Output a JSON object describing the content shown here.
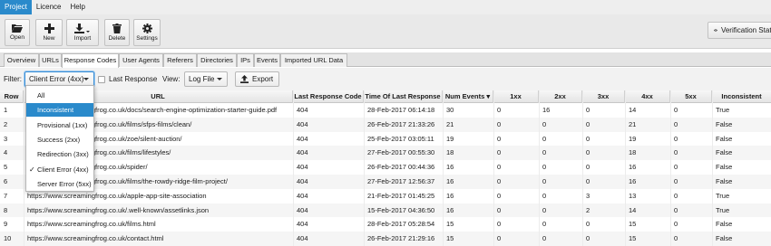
{
  "menu": [
    {
      "label": "Project",
      "active": true
    },
    {
      "label": "Licence",
      "active": false
    },
    {
      "label": "Help",
      "active": false
    }
  ],
  "toolbar": {
    "open_label": "Open",
    "new_label": "New",
    "import_label": "Import",
    "delete_label": "Delete",
    "settings_label": "Settings",
    "verification_label": "Verification Status"
  },
  "tabs": [
    "Overview",
    "URLs",
    "Response Codes",
    "User Agents",
    "Referers",
    "Directories",
    "IPs",
    "Events",
    "Imported URL Data"
  ],
  "active_tab": "Response Codes",
  "filter": {
    "filter_label": "Filter:",
    "filter_value": "Client Error (4xx)",
    "last_response_label": "Last Response",
    "view_label": "View:",
    "view_value": "Log File",
    "export_label": "Export"
  },
  "dropdown": {
    "options": [
      "All",
      "Inconsistent",
      "Provisional (1xx)",
      "Success (2xx)",
      "Redirection (3xx)",
      "Client Error (4xx)",
      "Server Error (5xx)"
    ],
    "highlighted": "Inconsistent",
    "checked": "Client Error (4xx)",
    "check_mark": "✓"
  },
  "table": {
    "columns": [
      "Row",
      "URL",
      "Last Response Code",
      "Time Of Last Response",
      "Num Events ▾",
      "1xx",
      "2xx",
      "3xx",
      "4xx",
      "5xx",
      "Inconsistent"
    ],
    "rows": [
      [
        "1",
        "https://www.screamingfrog.co.uk/docs/search-engine-optimization-starter-guide.pdf",
        "404",
        "28-Feb-2017 06:14:18",
        "30",
        "0",
        "16",
        "0",
        "14",
        "0",
        "True"
      ],
      [
        "2",
        "https://www.screamingfrog.co.uk/films/sfps-films/clean/",
        "404",
        "26-Feb-2017 21:33:26",
        "21",
        "0",
        "0",
        "0",
        "21",
        "0",
        "False"
      ],
      [
        "3",
        "https://www.screamingfrog.co.uk/zoe/silent-auction/",
        "404",
        "25-Feb-2017 03:05:11",
        "19",
        "0",
        "0",
        "0",
        "19",
        "0",
        "False"
      ],
      [
        "4",
        "https://www.screamingfrog.co.uk/films/lifestyles/",
        "404",
        "27-Feb-2017 00:55:30",
        "18",
        "0",
        "0",
        "0",
        "18",
        "0",
        "False"
      ],
      [
        "5",
        "https://www.screamingfrog.co.uk/spider/",
        "404",
        "26-Feb-2017 00:44:36",
        "16",
        "0",
        "0",
        "0",
        "16",
        "0",
        "False"
      ],
      [
        "6",
        "https://www.screamingfrog.co.uk/films/the-rowdy-ridge-film-project/",
        "404",
        "27-Feb-2017 12:56:37",
        "16",
        "0",
        "0",
        "0",
        "16",
        "0",
        "False"
      ],
      [
        "7",
        "https://www.screamingfrog.co.uk/apple-app-site-association",
        "404",
        "21-Feb-2017 01:45:25",
        "16",
        "0",
        "0",
        "3",
        "13",
        "0",
        "True"
      ],
      [
        "8",
        "https://www.screamingfrog.co.uk/.well-known/assetlinks.json",
        "404",
        "15-Feb-2017 04:36:50",
        "16",
        "0",
        "0",
        "2",
        "14",
        "0",
        "True"
      ],
      [
        "9",
        "https://www.screamingfrog.co.uk/films.html",
        "404",
        "28-Feb-2017 05:28:54",
        "15",
        "0",
        "0",
        "0",
        "15",
        "0",
        "False"
      ],
      [
        "10",
        "https://www.screamingfrog.co.uk/contact.html",
        "404",
        "26-Feb-2017 21:29:16",
        "15",
        "0",
        "0",
        "0",
        "15",
        "0",
        "False"
      ]
    ]
  },
  "colors": {
    "accent": "#2a8acb",
    "menubar_bg": "#eeeeee",
    "toolbar_bg": "#e9e9e9"
  }
}
